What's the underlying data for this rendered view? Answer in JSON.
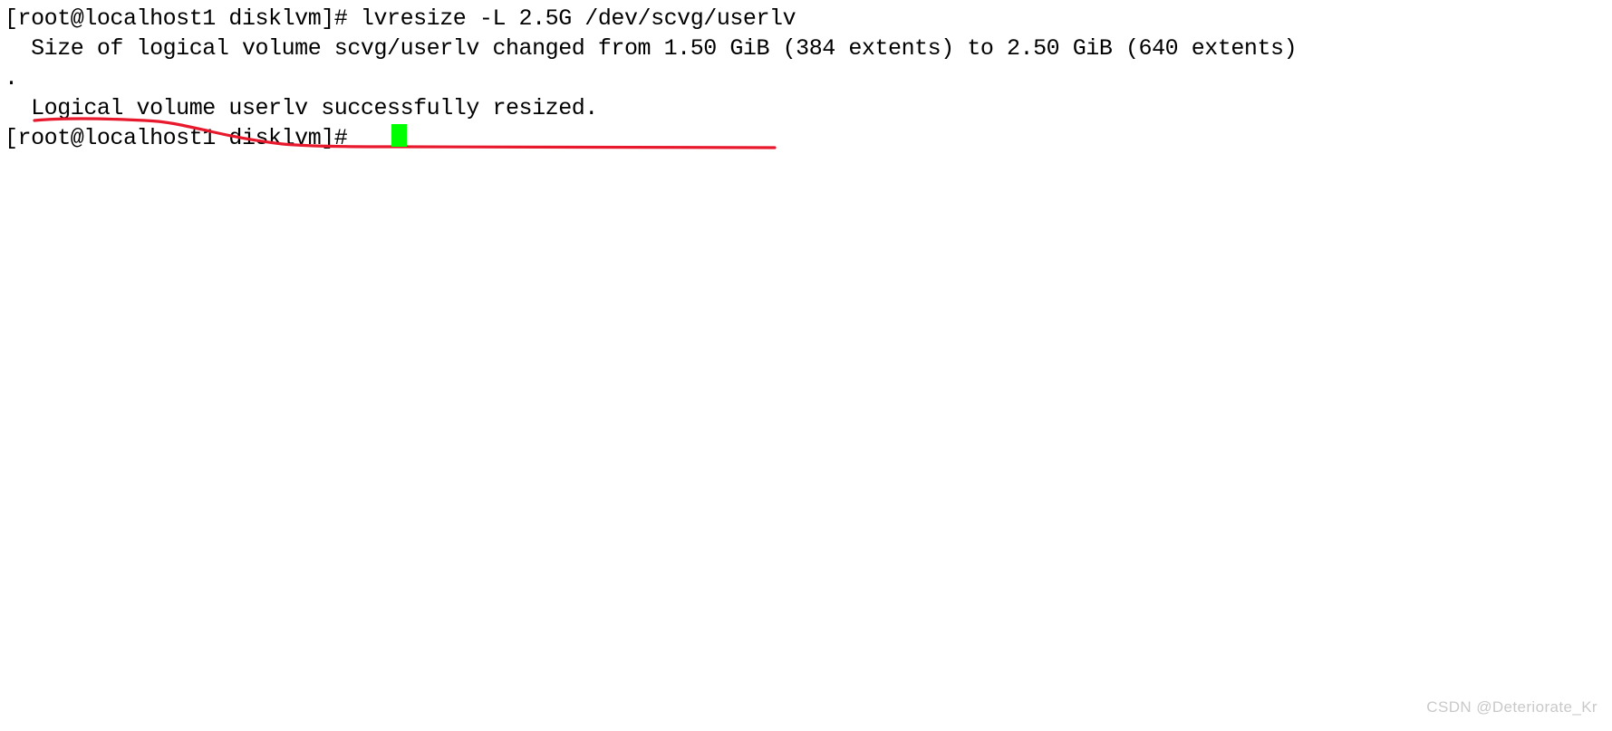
{
  "terminal": {
    "prompt": "[root@localhost1 disklvm]#",
    "lines": [
      "[root@localhost1 disklvm]# lvresize -L 2.5G /dev/scvg/userlv",
      "  Size of logical volume scvg/userlv changed from 1.50 GiB (384 extents) to 2.50 GiB (640 extents)",
      ".",
      "  Logical volume userlv successfully resized.",
      "[root@localhost1 disklvm]# "
    ],
    "command": "lvresize -L 2.5G /dev/scvg/userlv",
    "volume_group": "scvg",
    "logical_volume": "userlv",
    "device_path": "/dev/scvg/userlv",
    "size_old": "1.50 GiB",
    "extents_old": "384 extents",
    "size_new": "2.50 GiB",
    "extents_new": "640 extents",
    "requested_size": "2.5G",
    "result_message": "Logical volume userlv successfully resized.",
    "text_color": "#000000",
    "background_color": "#ffffff"
  },
  "annotation": {
    "type": "freehand-underline",
    "color": "#e8192c",
    "stroke_width": 3
  },
  "cursor": {
    "style": "block",
    "color": "#00ff00"
  },
  "watermark": {
    "text": "CSDN @Deteriorate_Kr",
    "color": "#c9c9c9"
  }
}
